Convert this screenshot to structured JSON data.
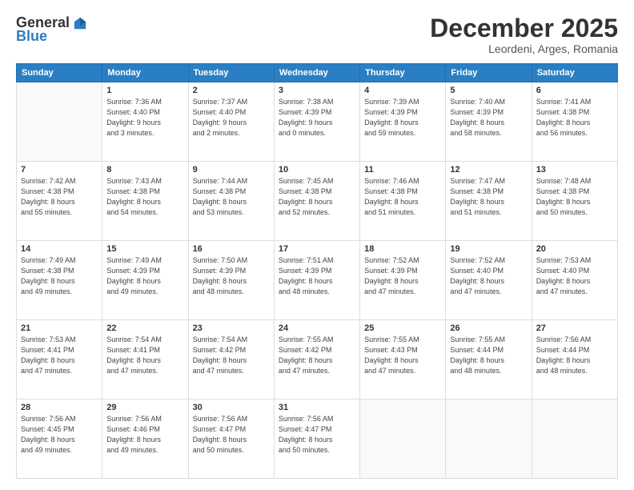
{
  "logo": {
    "general": "General",
    "blue": "Blue"
  },
  "title": "December 2025",
  "location": "Leordeni, Arges, Romania",
  "days_header": [
    "Sunday",
    "Monday",
    "Tuesday",
    "Wednesday",
    "Thursday",
    "Friday",
    "Saturday"
  ],
  "weeks": [
    [
      {
        "day": "",
        "info": ""
      },
      {
        "day": "1",
        "info": "Sunrise: 7:36 AM\nSunset: 4:40 PM\nDaylight: 9 hours\nand 3 minutes."
      },
      {
        "day": "2",
        "info": "Sunrise: 7:37 AM\nSunset: 4:40 PM\nDaylight: 9 hours\nand 2 minutes."
      },
      {
        "day": "3",
        "info": "Sunrise: 7:38 AM\nSunset: 4:39 PM\nDaylight: 9 hours\nand 0 minutes."
      },
      {
        "day": "4",
        "info": "Sunrise: 7:39 AM\nSunset: 4:39 PM\nDaylight: 8 hours\nand 59 minutes."
      },
      {
        "day": "5",
        "info": "Sunrise: 7:40 AM\nSunset: 4:39 PM\nDaylight: 8 hours\nand 58 minutes."
      },
      {
        "day": "6",
        "info": "Sunrise: 7:41 AM\nSunset: 4:38 PM\nDaylight: 8 hours\nand 56 minutes."
      }
    ],
    [
      {
        "day": "7",
        "info": "Sunrise: 7:42 AM\nSunset: 4:38 PM\nDaylight: 8 hours\nand 55 minutes."
      },
      {
        "day": "8",
        "info": "Sunrise: 7:43 AM\nSunset: 4:38 PM\nDaylight: 8 hours\nand 54 minutes."
      },
      {
        "day": "9",
        "info": "Sunrise: 7:44 AM\nSunset: 4:38 PM\nDaylight: 8 hours\nand 53 minutes."
      },
      {
        "day": "10",
        "info": "Sunrise: 7:45 AM\nSunset: 4:38 PM\nDaylight: 8 hours\nand 52 minutes."
      },
      {
        "day": "11",
        "info": "Sunrise: 7:46 AM\nSunset: 4:38 PM\nDaylight: 8 hours\nand 51 minutes."
      },
      {
        "day": "12",
        "info": "Sunrise: 7:47 AM\nSunset: 4:38 PM\nDaylight: 8 hours\nand 51 minutes."
      },
      {
        "day": "13",
        "info": "Sunrise: 7:48 AM\nSunset: 4:38 PM\nDaylight: 8 hours\nand 50 minutes."
      }
    ],
    [
      {
        "day": "14",
        "info": "Sunrise: 7:49 AM\nSunset: 4:38 PM\nDaylight: 8 hours\nand 49 minutes."
      },
      {
        "day": "15",
        "info": "Sunrise: 7:49 AM\nSunset: 4:39 PM\nDaylight: 8 hours\nand 49 minutes."
      },
      {
        "day": "16",
        "info": "Sunrise: 7:50 AM\nSunset: 4:39 PM\nDaylight: 8 hours\nand 48 minutes."
      },
      {
        "day": "17",
        "info": "Sunrise: 7:51 AM\nSunset: 4:39 PM\nDaylight: 8 hours\nand 48 minutes."
      },
      {
        "day": "18",
        "info": "Sunrise: 7:52 AM\nSunset: 4:39 PM\nDaylight: 8 hours\nand 47 minutes."
      },
      {
        "day": "19",
        "info": "Sunrise: 7:52 AM\nSunset: 4:40 PM\nDaylight: 8 hours\nand 47 minutes."
      },
      {
        "day": "20",
        "info": "Sunrise: 7:53 AM\nSunset: 4:40 PM\nDaylight: 8 hours\nand 47 minutes."
      }
    ],
    [
      {
        "day": "21",
        "info": "Sunrise: 7:53 AM\nSunset: 4:41 PM\nDaylight: 8 hours\nand 47 minutes."
      },
      {
        "day": "22",
        "info": "Sunrise: 7:54 AM\nSunset: 4:41 PM\nDaylight: 8 hours\nand 47 minutes."
      },
      {
        "day": "23",
        "info": "Sunrise: 7:54 AM\nSunset: 4:42 PM\nDaylight: 8 hours\nand 47 minutes."
      },
      {
        "day": "24",
        "info": "Sunrise: 7:55 AM\nSunset: 4:42 PM\nDaylight: 8 hours\nand 47 minutes."
      },
      {
        "day": "25",
        "info": "Sunrise: 7:55 AM\nSunset: 4:43 PM\nDaylight: 8 hours\nand 47 minutes."
      },
      {
        "day": "26",
        "info": "Sunrise: 7:55 AM\nSunset: 4:44 PM\nDaylight: 8 hours\nand 48 minutes."
      },
      {
        "day": "27",
        "info": "Sunrise: 7:56 AM\nSunset: 4:44 PM\nDaylight: 8 hours\nand 48 minutes."
      }
    ],
    [
      {
        "day": "28",
        "info": "Sunrise: 7:56 AM\nSunset: 4:45 PM\nDaylight: 8 hours\nand 49 minutes."
      },
      {
        "day": "29",
        "info": "Sunrise: 7:56 AM\nSunset: 4:46 PM\nDaylight: 8 hours\nand 49 minutes."
      },
      {
        "day": "30",
        "info": "Sunrise: 7:56 AM\nSunset: 4:47 PM\nDaylight: 8 hours\nand 50 minutes."
      },
      {
        "day": "31",
        "info": "Sunrise: 7:56 AM\nSunset: 4:47 PM\nDaylight: 8 hours\nand 50 minutes."
      },
      {
        "day": "",
        "info": ""
      },
      {
        "day": "",
        "info": ""
      },
      {
        "day": "",
        "info": ""
      }
    ]
  ]
}
